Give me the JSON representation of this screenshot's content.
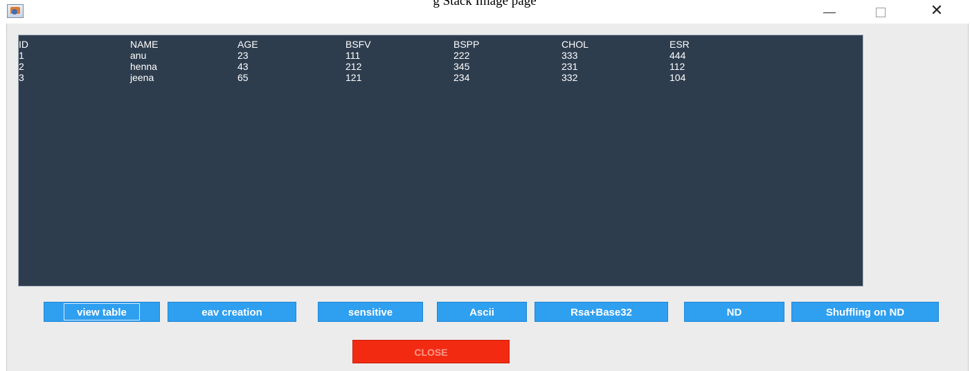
{
  "window": {
    "title": "g Stack Image page",
    "icon": "java-cup-icon",
    "controls": {
      "minimize": "—",
      "maximize": "□",
      "close": "✕"
    }
  },
  "table": {
    "headers": [
      "ID",
      "NAME",
      "AGE",
      "BSFV",
      "BSPP",
      "CHOL",
      "ESR"
    ],
    "rows": [
      [
        "1",
        "anu",
        "23",
        "111",
        "222",
        "333",
        "444"
      ],
      [
        "2",
        "henna",
        "43",
        "212",
        "345",
        "231",
        "112"
      ],
      [
        "3",
        "jeena",
        "65",
        "121",
        "234",
        "332",
        "104"
      ]
    ]
  },
  "buttons": {
    "view_table": "view table",
    "eav_creation": "eav creation",
    "sensitive": "sensitive",
    "ascii": "Ascii",
    "rsa_base32": "Rsa+Base32",
    "nd": "ND",
    "shuffling_nd": "Shuffling on ND",
    "close": "CLOSE"
  },
  "colors": {
    "table_bg": "#2e3d4e",
    "button_bg": "#2f9ff0",
    "close_bg": "#f32a12",
    "frame_bg": "#ececec"
  }
}
